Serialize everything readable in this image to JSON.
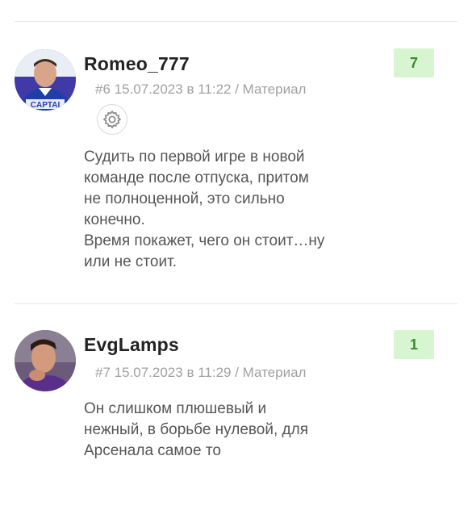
{
  "comments": [
    {
      "author": "Romeo_777",
      "meta": "#6 15.07.2023 в 11:22 / Материал",
      "rating": "7",
      "lines": [
        "Судить по первой игре в новой",
        "команде после отпуска, притом",
        "не полноценной, это сильно",
        "конечно.",
        "Время покажет, чего он стоит…ну",
        "или не стоит."
      ],
      "avatar_text": "CAPTAI"
    },
    {
      "author": "EvgLamps",
      "meta": "#7 15.07.2023 в 11:29 / Материал",
      "rating": "1",
      "lines": [
        "Он слишком плюшевый и",
        "нежный, в борьбе нулевой, для",
        "Арсенала самое то"
      ]
    }
  ],
  "colors": {
    "rating_bg": "#d6f5d0",
    "rating_text": "#3c8a2e",
    "meta_text": "#a0a0a0"
  },
  "icons": [
    "gear-icon"
  ]
}
